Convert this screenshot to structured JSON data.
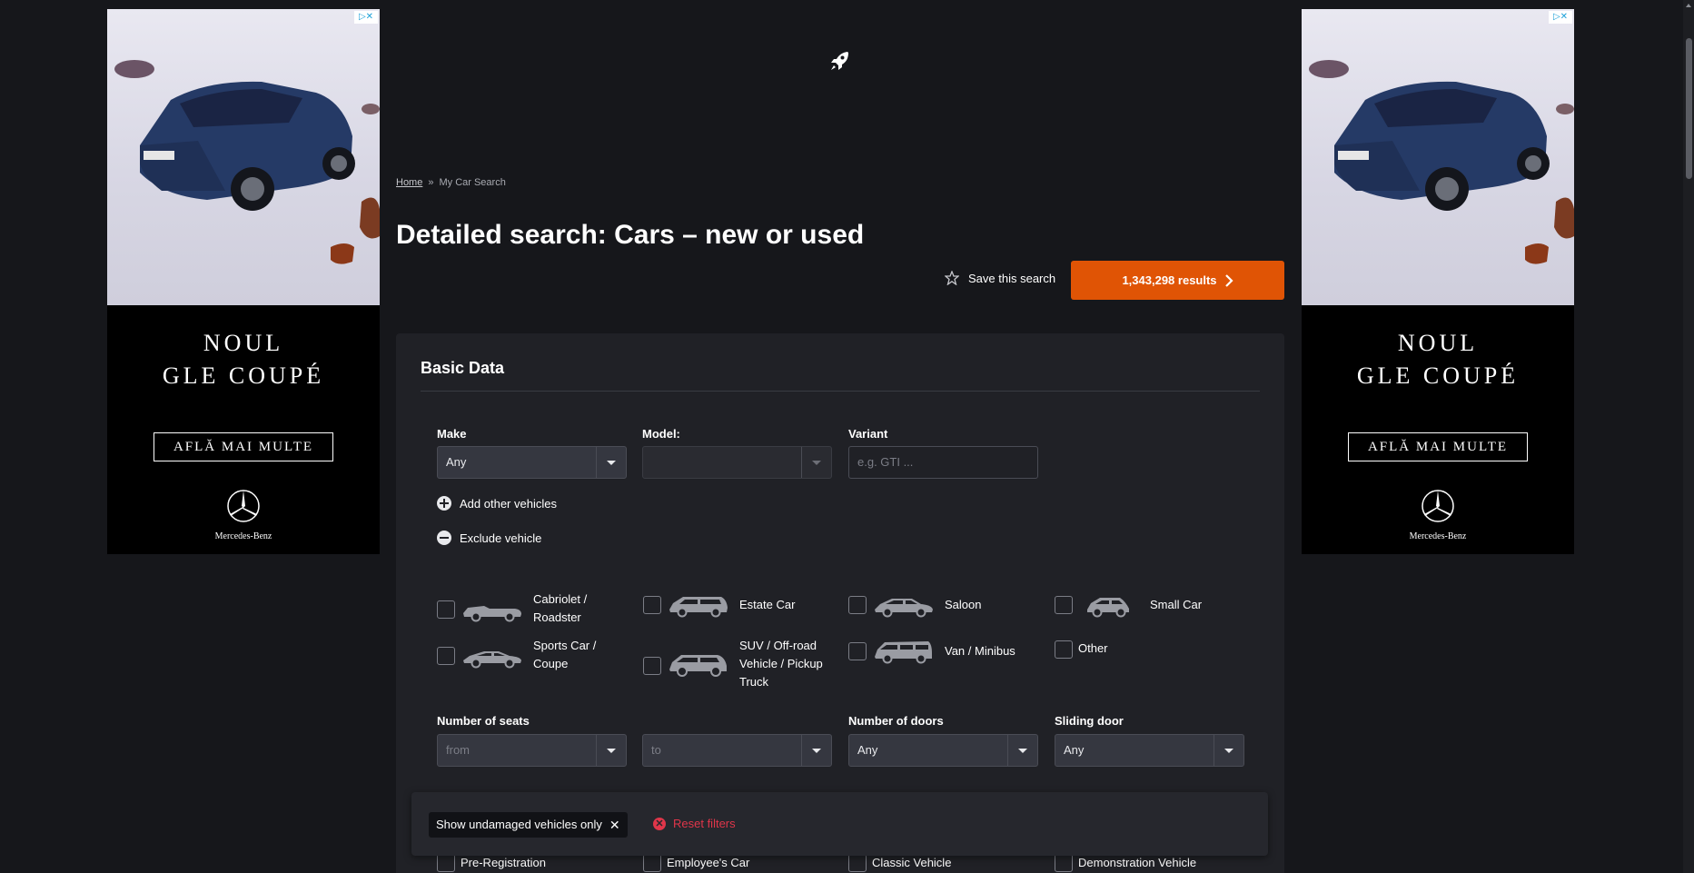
{
  "ads": {
    "left": {
      "headline_line1": "NOUL",
      "headline_line2": "GLE COUPÉ",
      "cta": "AFLĂ MAI MULTE",
      "brand": "Mercedes-Benz",
      "adchoices": "▷✕"
    },
    "right": {
      "headline_line1": "NOUL",
      "headline_line2": "GLE COUPÉ",
      "cta": "AFLĂ MAI MULTE",
      "brand": "Mercedes-Benz",
      "adchoices": "▷✕"
    }
  },
  "breadcrumb": {
    "home": "Home",
    "separator": "»",
    "current": "My Car Search"
  },
  "page_title": "Detailed search: Cars – new or used",
  "save_search": "Save this search",
  "results_button": "1,343,298 results",
  "basic_data": {
    "title": "Basic Data",
    "make_label": "Make",
    "make_value": "Any",
    "model_label": "Model:",
    "model_value": "",
    "variant_label": "Variant",
    "variant_placeholder": "e.g. GTI ...",
    "add_vehicles": "Add other vehicles",
    "exclude_vehicle": "Exclude vehicle"
  },
  "vehicle_types": [
    {
      "line1": "Cabriolet /",
      "line2": "Roadster",
      "line3": ""
    },
    {
      "line1": "Estate Car",
      "line2": "",
      "line3": ""
    },
    {
      "line1": "Saloon",
      "line2": "",
      "line3": ""
    },
    {
      "line1": "Small Car",
      "line2": "",
      "line3": ""
    },
    {
      "line1": "Sports Car /",
      "line2": "Coupe",
      "line3": ""
    },
    {
      "line1": "SUV / Off-road",
      "line2": "Vehicle / Pickup",
      "line3": "Truck"
    },
    {
      "line1": "Van / Minibus",
      "line2": "",
      "line3": ""
    },
    {
      "line1": "Other",
      "line2": "",
      "line3": ""
    }
  ],
  "seats": {
    "label": "Number of seats",
    "from": "from",
    "to": "to"
  },
  "doors": {
    "label": "Number of doors",
    "value": "Any"
  },
  "sliding_door": {
    "label": "Sliding door",
    "value": "Any"
  },
  "bottom_checks": [
    "Pre-Registration",
    "Employee's Car",
    "Classic Vehicle",
    "Demonstration Vehicle"
  ],
  "footer": {
    "chip": "Show undamaged vehicles only",
    "chip_close": "✕",
    "reset": "Reset filters",
    "reset_icon": "✕"
  },
  "colors": {
    "accent": "#e05405",
    "background": "#16171b",
    "panel": "#202126",
    "reset": "#e0364a"
  }
}
